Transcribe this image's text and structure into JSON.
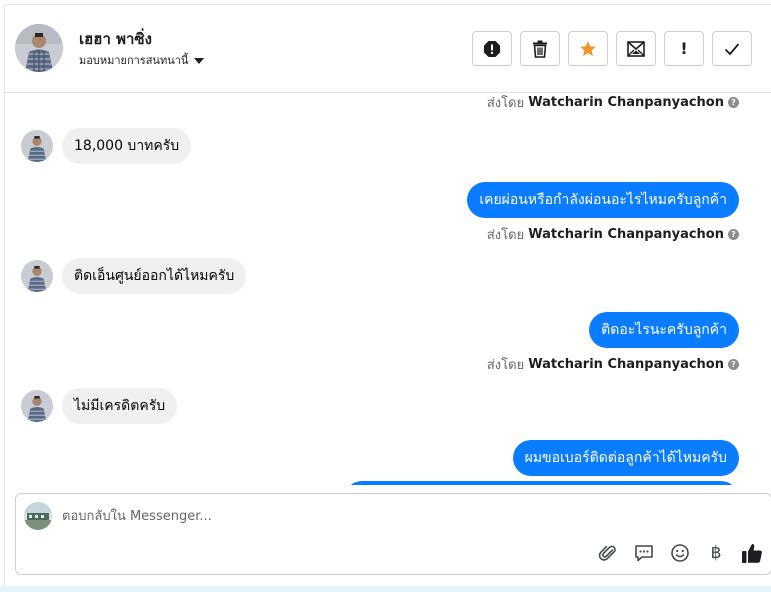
{
  "contact": {
    "name": "เฮฮา พาซิ่ง",
    "assign_label": "มอบหมายการสนทนานี้"
  },
  "toolbar": [
    {
      "name": "spam-icon"
    },
    {
      "name": "trash-icon"
    },
    {
      "name": "star-icon",
      "color": "#f2922b"
    },
    {
      "name": "mark-unread-icon"
    },
    {
      "name": "follow-up-icon",
      "glyph": "!"
    },
    {
      "name": "check-icon"
    }
  ],
  "sent_by_prefix": "ส่งโดย",
  "agent_name": "Watcharin Chanpanyachon",
  "messages": [
    {
      "dir": "in",
      "text": "18,000 บาทครับ"
    },
    {
      "dir": "out",
      "text": "เคยผ่อนหรือกำลังผ่อนอะไรไหมครับลูกค้า"
    },
    {
      "dir": "in",
      "text": "ติดเอ็นศูนย์ออกได้ไหมครับ"
    },
    {
      "dir": "out",
      "text": "ติดอะไรนะครับลูกค้า"
    },
    {
      "dir": "in",
      "text": "ไม่มีเครดิตครับ"
    },
    {
      "dir": "out",
      "text": "ผมขอเบอร์ติดต่อลูกค้าได้ไหมครับ"
    }
  ],
  "composer": {
    "placeholder": "ตอบกลับใน Messenger...",
    "baht_glyph": "฿"
  },
  "colors": {
    "outgoing_bubble": "#0a7cff",
    "incoming_bubble": "#f0f0f0",
    "like": "#1c1e21"
  }
}
